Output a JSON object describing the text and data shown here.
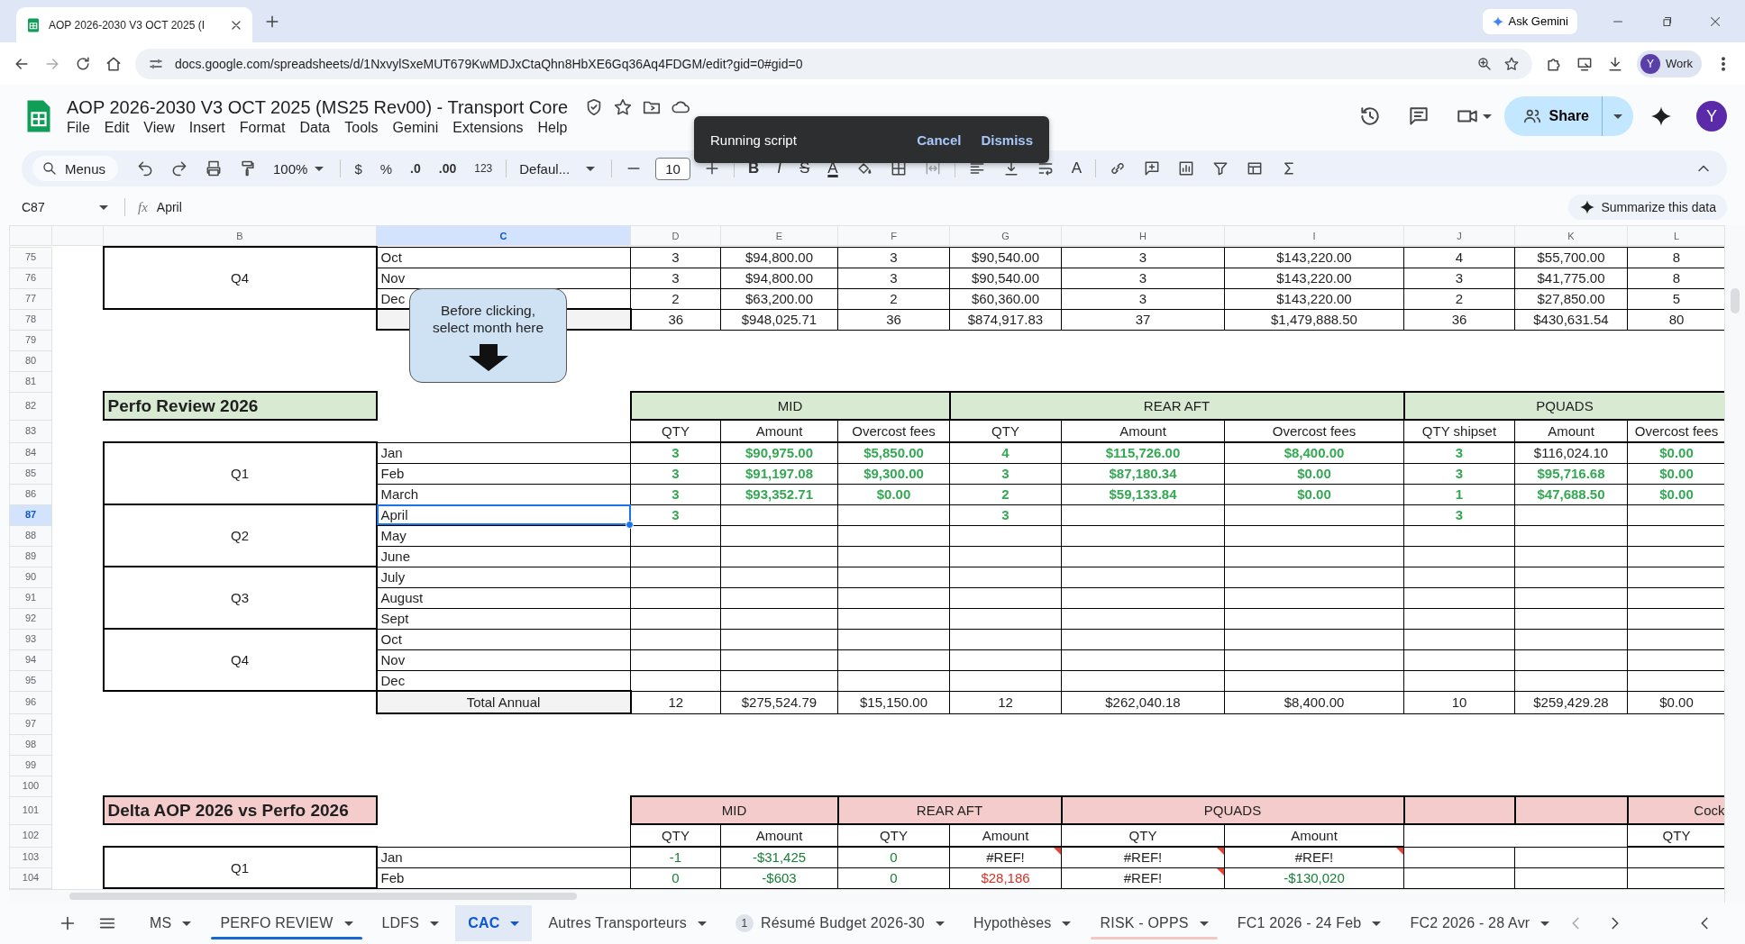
{
  "browser": {
    "tab_title": "AOP 2026-2030 V3 OCT 2025 (I",
    "ask_button": "Ask Gemini",
    "url": "docs.google.com/spreadsheets/d/1NxvylSxeMUT679KwMDJxCtaQhn8HbXE6Gq36Aq4FDGM/edit?gid=0#gid=0",
    "profile_initial": "Y",
    "profile_label": "Work"
  },
  "doc": {
    "title": "AOP 2026-2030 V3 OCT 2025 (MS25 Rev00) - Transport Core",
    "menus": [
      "File",
      "Edit",
      "View",
      "Insert",
      "Format",
      "Data",
      "Tools",
      "Gemini",
      "Extensions",
      "Help"
    ],
    "share": "Share",
    "avatar": "Y"
  },
  "toolbar": {
    "search": "Menus",
    "zoom": "100%",
    "currency": "$",
    "percent": "%",
    "decimal_less": ".0",
    "decimal_more": ".00",
    "number_format": "123",
    "font": "Defaul...",
    "font_size": "10",
    "format_letters": [
      {
        "kind": "bold",
        "text": "B"
      },
      {
        "kind": "italic",
        "text": "I"
      },
      {
        "kind": "strike",
        "text": "S"
      },
      {
        "kind": "color",
        "text": "A"
      }
    ],
    "rotate_letter": "A"
  },
  "toast": {
    "message": "Running script",
    "actions": [
      "Cancel",
      "Dismiss"
    ]
  },
  "formula_bar": {
    "cell_ref": "C87",
    "function_label": "fx",
    "formula": "April",
    "summarize": "Summarize this data"
  },
  "grid": {
    "columns": [
      {
        "label": "B",
        "selected": false
      },
      {
        "label": "C",
        "selected": true
      },
      {
        "label": "D",
        "selected": false
      },
      {
        "label": "E",
        "selected": false
      },
      {
        "label": "F",
        "selected": false
      },
      {
        "label": "G",
        "selected": false
      },
      {
        "label": "H",
        "selected": false
      },
      {
        "label": "I",
        "selected": false
      },
      {
        "label": "J",
        "selected": false
      },
      {
        "label": "K",
        "selected": false
      },
      {
        "label": "L",
        "selected": false
      }
    ],
    "rows": [
      {
        "number": "75",
        "selected": false,
        "cells": [
          {
            "kind": "quarter",
            "text": "Q4"
          },
          {
            "kind": "month",
            "text": "Oct"
          },
          {
            "kind": "cell",
            "text": "3"
          },
          {
            "kind": "cell",
            "text": "$94,800.00"
          },
          {
            "kind": "cell",
            "text": "3"
          },
          {
            "kind": "cell",
            "text": "$90,540.00"
          },
          {
            "kind": "cell",
            "text": "3"
          },
          {
            "kind": "cell",
            "text": "$143,220.00"
          },
          {
            "kind": "cell",
            "text": "4"
          },
          {
            "kind": "cell",
            "text": "$55,700.00"
          },
          {
            "kind": "cell",
            "text": "8"
          }
        ]
      },
      {
        "number": "76",
        "selected": false,
        "cells": [
          {
            "kind": "covered"
          },
          {
            "kind": "month",
            "text": "Nov"
          },
          {
            "kind": "cell",
            "text": "3"
          },
          {
            "kind": "cell",
            "text": "$94,800.00"
          },
          {
            "kind": "cell",
            "text": "3"
          },
          {
            "kind": "cell",
            "text": "$90,540.00"
          },
          {
            "kind": "cell",
            "text": "3"
          },
          {
            "kind": "cell",
            "text": "$143,220.00"
          },
          {
            "kind": "cell",
            "text": "3"
          },
          {
            "kind": "cell",
            "text": "$41,775.00"
          },
          {
            "kind": "cell",
            "text": "8"
          }
        ]
      },
      {
        "number": "77",
        "selected": false,
        "cells": [
          {
            "kind": "covered"
          },
          {
            "kind": "month",
            "text": "Dec"
          },
          {
            "kind": "cell",
            "text": "2"
          },
          {
            "kind": "cell",
            "text": "$63,200.00"
          },
          {
            "kind": "cell",
            "text": "2"
          },
          {
            "kind": "cell",
            "text": "$60,360.00"
          },
          {
            "kind": "cell",
            "text": "3"
          },
          {
            "kind": "cell",
            "text": "$143,220.00"
          },
          {
            "kind": "cell",
            "text": "2"
          },
          {
            "kind": "cell",
            "text": "$27,850.00"
          },
          {
            "kind": "cell",
            "text": "5"
          }
        ]
      },
      {
        "number": "78",
        "selected": false,
        "cells": [
          {
            "kind": "blank"
          },
          {
            "kind": "total"
          },
          {
            "kind": "cell",
            "text": "36"
          },
          {
            "kind": "cell",
            "text": "$948,025.71"
          },
          {
            "kind": "cell",
            "text": "36"
          },
          {
            "kind": "cell",
            "text": "$874,917.83"
          },
          {
            "kind": "cell",
            "text": "37"
          },
          {
            "kind": "cell",
            "text": "$1,479,888.50"
          },
          {
            "kind": "cell",
            "text": "36"
          },
          {
            "kind": "cell",
            "text": "$430,631.54"
          },
          {
            "kind": "cell",
            "text": "80"
          }
        ]
      },
      {
        "number": "79",
        "selected": false
      },
      {
        "number": "80",
        "selected": false
      },
      {
        "number": "81",
        "selected": false
      },
      {
        "number": "82",
        "selected": false,
        "cells": [
          {
            "kind": "title_green",
            "text": "Perfo Review 2026"
          },
          {
            "kind": "blank"
          },
          {
            "kind": "band_green",
            "text": "MID"
          },
          {
            "kind": "merged"
          },
          {
            "kind": "merged"
          },
          {
            "kind": "band_green",
            "text": "REAR AFT"
          },
          {
            "kind": "merged"
          },
          {
            "kind": "merged"
          },
          {
            "kind": "band_green",
            "text": "PQUADS"
          },
          {
            "kind": "merged"
          },
          {
            "kind": "merged"
          }
        ]
      },
      {
        "number": "83",
        "selected": false,
        "cells": [
          {
            "kind": "blank"
          },
          {
            "kind": "blank"
          },
          {
            "kind": "head",
            "text": "QTY"
          },
          {
            "kind": "head",
            "text": "Amount"
          },
          {
            "kind": "head",
            "text": "Overcost fees"
          },
          {
            "kind": "head",
            "text": "QTY"
          },
          {
            "kind": "head",
            "text": "Amount"
          },
          {
            "kind": "head",
            "text": "Overcost fees"
          },
          {
            "kind": "head",
            "text": "QTY shipset"
          },
          {
            "kind": "head",
            "text": "Amount"
          },
          {
            "kind": "head",
            "text": "Overcost fees"
          }
        ]
      },
      {
        "number": "84",
        "selected": false,
        "cells": [
          {
            "kind": "quarter",
            "text": "Q1"
          },
          {
            "kind": "month",
            "text": "Jan"
          },
          {
            "kind": "good",
            "text": "3"
          },
          {
            "kind": "good",
            "text": "$90,975.00"
          },
          {
            "kind": "good",
            "text": "$5,850.00"
          },
          {
            "kind": "good",
            "text": "4"
          },
          {
            "kind": "good",
            "text": "$115,726.00"
          },
          {
            "kind": "good",
            "text": "$8,400.00"
          },
          {
            "kind": "good",
            "text": "3"
          },
          {
            "kind": "cell",
            "text": "$116,024.10"
          },
          {
            "kind": "good",
            "text": "$0.00"
          }
        ]
      },
      {
        "number": "85",
        "selected": false,
        "cells": [
          {
            "kind": "covered"
          },
          {
            "kind": "month",
            "text": "Feb"
          },
          {
            "kind": "good",
            "text": "3"
          },
          {
            "kind": "good",
            "text": "$91,197.08"
          },
          {
            "kind": "good",
            "text": "$9,300.00"
          },
          {
            "kind": "good",
            "text": "3"
          },
          {
            "kind": "good",
            "text": "$87,180.34"
          },
          {
            "kind": "good",
            "text": "$0.00"
          },
          {
            "kind": "good",
            "text": "3"
          },
          {
            "kind": "good",
            "text": "$95,716.68"
          },
          {
            "kind": "good",
            "text": "$0.00"
          }
        ]
      },
      {
        "number": "86",
        "selected": false,
        "cells": [
          {
            "kind": "covered"
          },
          {
            "kind": "month",
            "text": "March"
          },
          {
            "kind": "good",
            "text": "3"
          },
          {
            "kind": "good",
            "text": "$93,352.71"
          },
          {
            "kind": "good",
            "text": "$0.00"
          },
          {
            "kind": "good",
            "text": "2"
          },
          {
            "kind": "good",
            "text": "$59,133.84"
          },
          {
            "kind": "good",
            "text": "$0.00"
          },
          {
            "kind": "good",
            "text": "1"
          },
          {
            "kind": "good",
            "text": "$47,688.50"
          },
          {
            "kind": "good",
            "text": "$0.00"
          }
        ]
      },
      {
        "number": "87",
        "selected": true,
        "cells": [
          {
            "kind": "quarter",
            "text": "Q2"
          },
          {
            "kind": "month",
            "text": "April"
          },
          {
            "kind": "good",
            "text": "3"
          },
          {
            "kind": "cell"
          },
          {
            "kind": "cell"
          },
          {
            "kind": "good",
            "text": "3"
          },
          {
            "kind": "cell"
          },
          {
            "kind": "cell"
          },
          {
            "kind": "good",
            "text": "3"
          },
          {
            "kind": "cell"
          },
          {
            "kind": "cell"
          }
        ]
      },
      {
        "number": "88",
        "selected": false,
        "cells": [
          {
            "kind": "covered"
          },
          {
            "kind": "month",
            "text": "May"
          },
          {
            "kind": "cell"
          },
          {
            "kind": "cell"
          },
          {
            "kind": "cell"
          },
          {
            "kind": "cell"
          },
          {
            "kind": "cell"
          },
          {
            "kind": "cell"
          },
          {
            "kind": "cell"
          },
          {
            "kind": "cell"
          },
          {
            "kind": "cell"
          }
        ]
      },
      {
        "number": "89",
        "selected": false,
        "cells": [
          {
            "kind": "covered"
          },
          {
            "kind": "month",
            "text": "June"
          },
          {
            "kind": "cell"
          },
          {
            "kind": "cell"
          },
          {
            "kind": "cell"
          },
          {
            "kind": "cell"
          },
          {
            "kind": "cell"
          },
          {
            "kind": "cell"
          },
          {
            "kind": "cell"
          },
          {
            "kind": "cell"
          },
          {
            "kind": "cell"
          }
        ]
      },
      {
        "number": "90",
        "selected": false,
        "cells": [
          {
            "kind": "quarter",
            "text": "Q3"
          },
          {
            "kind": "month",
            "text": "July"
          },
          {
            "kind": "cell"
          },
          {
            "kind": "cell"
          },
          {
            "kind": "cell"
          },
          {
            "kind": "cell"
          },
          {
            "kind": "cell"
          },
          {
            "kind": "cell"
          },
          {
            "kind": "cell"
          },
          {
            "kind": "cell"
          },
          {
            "kind": "cell"
          }
        ]
      },
      {
        "number": "91",
        "selected": false,
        "cells": [
          {
            "kind": "covered"
          },
          {
            "kind": "month",
            "text": "August"
          },
          {
            "kind": "cell"
          },
          {
            "kind": "cell"
          },
          {
            "kind": "cell"
          },
          {
            "kind": "cell"
          },
          {
            "kind": "cell"
          },
          {
            "kind": "cell"
          },
          {
            "kind": "cell"
          },
          {
            "kind": "cell"
          },
          {
            "kind": "cell"
          }
        ]
      },
      {
        "number": "92",
        "selected": false,
        "cells": [
          {
            "kind": "covered"
          },
          {
            "kind": "month",
            "text": "Sept"
          },
          {
            "kind": "cell"
          },
          {
            "kind": "cell"
          },
          {
            "kind": "cell"
          },
          {
            "kind": "cell"
          },
          {
            "kind": "cell"
          },
          {
            "kind": "cell"
          },
          {
            "kind": "cell"
          },
          {
            "kind": "cell"
          },
          {
            "kind": "cell"
          }
        ]
      },
      {
        "number": "93",
        "selected": false,
        "cells": [
          {
            "kind": "quarter",
            "text": "Q4"
          },
          {
            "kind": "month",
            "text": "Oct"
          },
          {
            "kind": "cell"
          },
          {
            "kind": "cell"
          },
          {
            "kind": "cell"
          },
          {
            "kind": "cell"
          },
          {
            "kind": "cell"
          },
          {
            "kind": "cell"
          },
          {
            "kind": "cell"
          },
          {
            "kind": "cell"
          },
          {
            "kind": "cell"
          }
        ]
      },
      {
        "number": "94",
        "selected": false,
        "cells": [
          {
            "kind": "covered"
          },
          {
            "kind": "month",
            "text": "Nov"
          },
          {
            "kind": "cell"
          },
          {
            "kind": "cell"
          },
          {
            "kind": "cell"
          },
          {
            "kind": "cell"
          },
          {
            "kind": "cell"
          },
          {
            "kind": "cell"
          },
          {
            "kind": "cell"
          },
          {
            "kind": "cell"
          },
          {
            "kind": "cell"
          }
        ]
      },
      {
        "number": "95",
        "selected": false,
        "cells": [
          {
            "kind": "covered"
          },
          {
            "kind": "month",
            "text": "Dec"
          },
          {
            "kind": "cell"
          },
          {
            "kind": "cell"
          },
          {
            "kind": "cell"
          },
          {
            "kind": "cell"
          },
          {
            "kind": "cell"
          },
          {
            "kind": "cell"
          },
          {
            "kind": "cell"
          },
          {
            "kind": "cell"
          },
          {
            "kind": "cell"
          }
        ]
      },
      {
        "number": "96",
        "selected": false,
        "cells": [
          {
            "kind": "blank"
          },
          {
            "kind": "total",
            "text": "Total Annual"
          },
          {
            "kind": "cell",
            "text": "12"
          },
          {
            "kind": "cell",
            "text": "$275,524.79"
          },
          {
            "kind": "cell",
            "text": "$15,150.00"
          },
          {
            "kind": "cell",
            "text": "12"
          },
          {
            "kind": "cell",
            "text": "$262,040.18"
          },
          {
            "kind": "cell",
            "text": "$8,400.00"
          },
          {
            "kind": "cell",
            "text": "10"
          },
          {
            "kind": "cell",
            "text": "$259,429.28"
          },
          {
            "kind": "cell",
            "text": "$0.00"
          }
        ]
      },
      {
        "number": "97",
        "selected": false
      },
      {
        "number": "98",
        "selected": false
      },
      {
        "number": "99",
        "selected": false
      },
      {
        "number": "100",
        "selected": false
      },
      {
        "number": "101",
        "selected": false,
        "cells": [
          {
            "kind": "title_red",
            "text": "Delta AOP 2026 vs Perfo 2026"
          },
          {
            "kind": "blank"
          },
          {
            "kind": "band_red",
            "text": "MID"
          },
          {
            "kind": "merged"
          },
          {
            "kind": "band_red",
            "text": "REAR AFT"
          },
          {
            "kind": "merged"
          },
          {
            "kind": "band_red",
            "text": "PQUADS"
          },
          {
            "kind": "merged"
          },
          {
            "kind": "band_red"
          },
          {
            "kind": "band_red"
          },
          {
            "kind": "band_red_edge",
            "text": "Cock"
          }
        ]
      },
      {
        "number": "102",
        "selected": false,
        "cells": [
          {
            "kind": "blank"
          },
          {
            "kind": "blank"
          },
          {
            "kind": "head",
            "text": "QTY"
          },
          {
            "kind": "head",
            "text": "Amount"
          },
          {
            "kind": "head",
            "text": "QTY"
          },
          {
            "kind": "head",
            "text": "Amount"
          },
          {
            "kind": "head",
            "text": "QTY"
          },
          {
            "kind": "head",
            "text": "Amount"
          },
          {
            "kind": "cell"
          },
          {
            "kind": "merged"
          },
          {
            "kind": "head",
            "text": "QTY"
          }
        ]
      },
      {
        "number": "103",
        "selected": false,
        "cells": [
          {
            "kind": "quarter",
            "text": "Q1"
          },
          {
            "kind": "month",
            "text": "Jan"
          },
          {
            "kind": "up",
            "text": "-1"
          },
          {
            "kind": "up",
            "text": "-$31,425"
          },
          {
            "kind": "up",
            "text": "0"
          },
          {
            "kind": "cell",
            "text": "#REF!",
            "note": true
          },
          {
            "kind": "cell",
            "text": "#REF!",
            "note": true
          },
          {
            "kind": "cell",
            "text": "#REF!",
            "note": true
          },
          {
            "kind": "cell"
          },
          {
            "kind": "cell"
          },
          {
            "kind": "cell"
          }
        ]
      },
      {
        "number": "104",
        "selected": false,
        "cells": [
          {
            "kind": "covered"
          },
          {
            "kind": "month",
            "text": "Feb"
          },
          {
            "kind": "up",
            "text": "0"
          },
          {
            "kind": "up",
            "text": "-$603"
          },
          {
            "kind": "up",
            "text": "0"
          },
          {
            "kind": "down",
            "text": "$28,186"
          },
          {
            "kind": "cell",
            "text": "#REF!",
            "note": true
          },
          {
            "kind": "up",
            "text": "-$130,020"
          },
          {
            "kind": "cell"
          },
          {
            "kind": "cell"
          },
          {
            "kind": "cell"
          }
        ]
      }
    ],
    "callout": "Before clicking, select month here"
  },
  "sheet_tabs": [
    {
      "label": "MS",
      "selected": false
    },
    {
      "label": "PERFO REVIEW",
      "selected": false,
      "color": "#1967d2"
    },
    {
      "label": "LDFS",
      "selected": false
    },
    {
      "label": "CAC",
      "selected": true
    },
    {
      "label": "Autres Transporteurs",
      "selected": false
    },
    {
      "label": "Résumé Budget 2026-30",
      "selected": false,
      "badge": "1"
    },
    {
      "label": "Hypothèses",
      "selected": false
    },
    {
      "label": "RISK - OPPS",
      "selected": false,
      "color": "#f4c7c3"
    },
    {
      "label": "FC1 2026 - 24 Feb",
      "selected": false
    },
    {
      "label": "FC2 2026 - 28 Avr",
      "selected": false
    }
  ]
}
